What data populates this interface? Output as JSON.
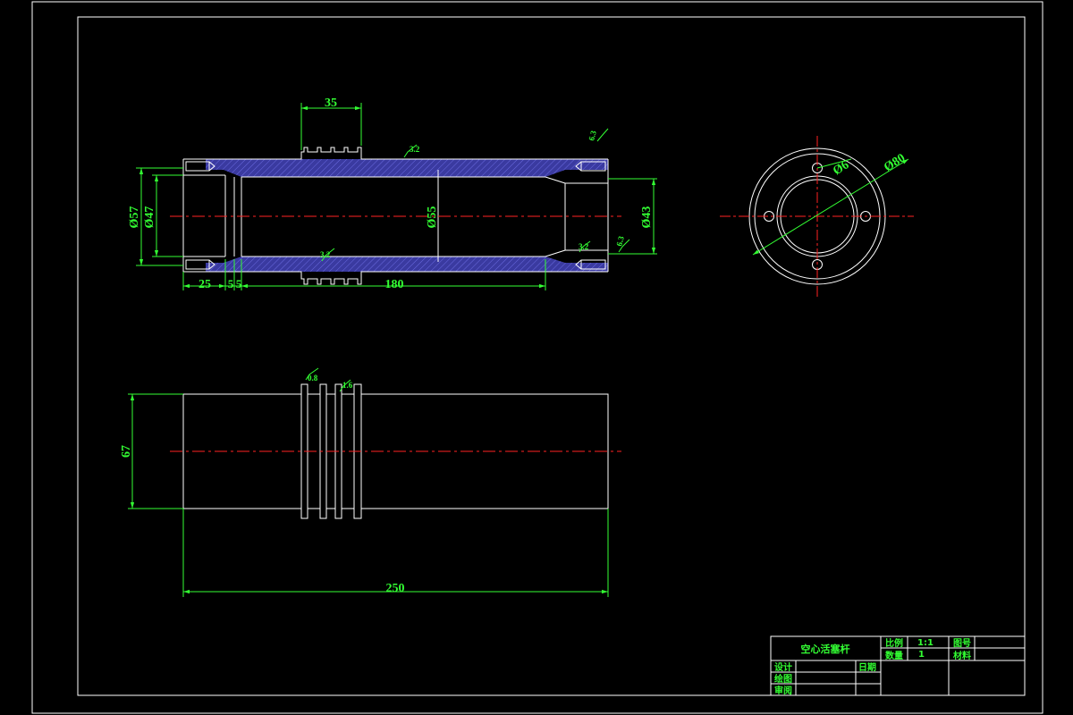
{
  "drawing": {
    "title": "空心活塞杆",
    "colors": {
      "background": "#000000",
      "outline": "#ffffff",
      "dimension": "#33ff33",
      "centerline": "#ff2222",
      "hatch": "#3a3aa0"
    },
    "section_view": {
      "dimensions": {
        "groove_width": "35",
        "outer_diameter_left": "Ø57",
        "bore_diameter_left": "Ø47",
        "bore_diameter_main": "Ø55",
        "bore_diameter_right": "Ø43",
        "length_left_counterbore": "25",
        "step_a": "5",
        "step_b": "5",
        "length_main_bore": "180"
      },
      "roughness": {
        "outer_top": "3.2",
        "top_right": "6.3",
        "inner_bottom": "3.2",
        "bottom_right_a": "3.2",
        "bottom_right_b": "6.3"
      }
    },
    "end_view": {
      "hole_diameter": "Ø6",
      "outer_diameter": "Ø80"
    },
    "side_view": {
      "height": "67",
      "total_length": "250",
      "roughness_a": "0.8",
      "roughness_b": "1.6"
    }
  },
  "title_block": {
    "part_name": "空心活塞杆",
    "scale_label": "比例",
    "scale_value": "1:1",
    "drawing_no_label": "图号",
    "quantity_label": "数量",
    "quantity_value": "1",
    "material_label": "材料",
    "designer_label": "设计",
    "date_label": "日期",
    "drafter_label": "绘图",
    "checker_label": "审阅"
  }
}
